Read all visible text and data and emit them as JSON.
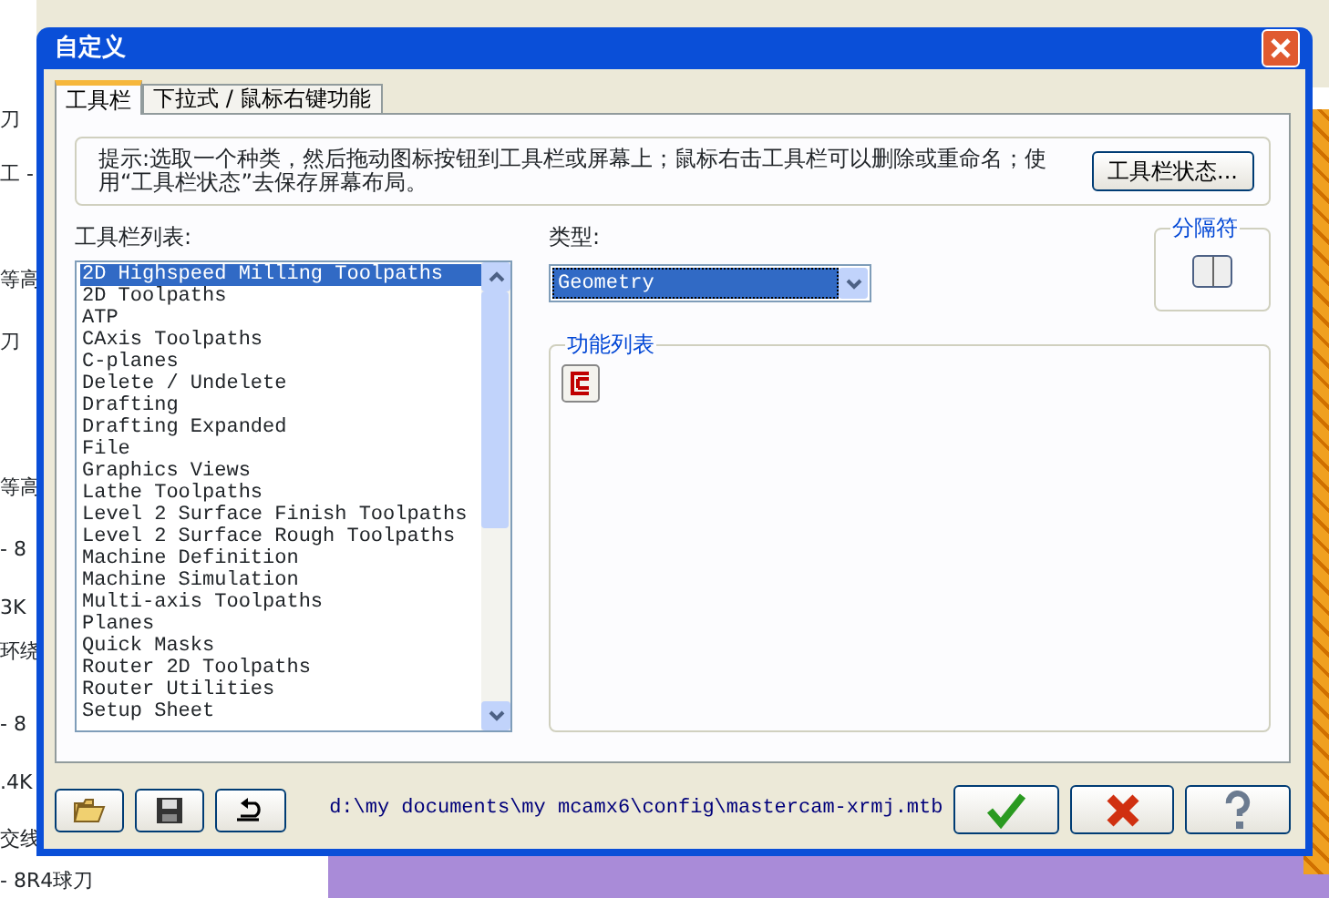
{
  "background": {
    "left_fragments": [
      "刀",
      "工 -",
      "等高",
      "刀",
      "等高",
      "- 8",
      "3K",
      "环绕",
      "- 8",
      ".4K",
      "交线",
      "- 8R4球刀"
    ]
  },
  "window": {
    "title": "自定义"
  },
  "tabs": [
    {
      "label": "工具栏",
      "selected": true
    },
    {
      "label": "下拉式 / 鼠标右键功能",
      "selected": false
    }
  ],
  "hint": "提示:选取一个种类，然后拖动图标按钮到工具栏或屏幕上；鼠标右击工具栏可以删除或重命名；使用“工具栏状态”去保存屏幕布局。",
  "state_button": "工具栏状态...",
  "toolbar_list": {
    "label": "工具栏列表:",
    "items": [
      {
        "label": "2D Highspeed Milling Toolpaths",
        "selected": true
      },
      {
        "label": "2D Toolpaths",
        "selected": false
      },
      {
        "label": "ATP",
        "selected": false
      },
      {
        "label": "CAxis Toolpaths",
        "selected": false
      },
      {
        "label": "C-planes",
        "selected": false
      },
      {
        "label": "Delete / Undelete",
        "selected": false
      },
      {
        "label": "Drafting",
        "selected": false
      },
      {
        "label": "Drafting Expanded",
        "selected": false
      },
      {
        "label": "File",
        "selected": false
      },
      {
        "label": "Graphics Views",
        "selected": false
      },
      {
        "label": "Lathe Toolpaths",
        "selected": false
      },
      {
        "label": "Level 2 Surface Finish Toolpaths",
        "selected": false
      },
      {
        "label": "Level 2 Surface Rough Toolpaths",
        "selected": false
      },
      {
        "label": "Machine Definition",
        "selected": false
      },
      {
        "label": "Machine Simulation",
        "selected": false
      },
      {
        "label": "Multi-axis Toolpaths",
        "selected": false
      },
      {
        "label": "Planes",
        "selected": false
      },
      {
        "label": "Quick Masks",
        "selected": false
      },
      {
        "label": "Router 2D Toolpaths",
        "selected": false
      },
      {
        "label": "Router Utilities",
        "selected": false
      },
      {
        "label": "Setup Sheet",
        "selected": false
      }
    ]
  },
  "type": {
    "label": "类型:",
    "value": "Geometry"
  },
  "separator": {
    "label": "分隔符"
  },
  "function_list": {
    "label": "功能列表"
  },
  "file_buttons": [
    {
      "kind": "open"
    },
    {
      "kind": "save"
    },
    {
      "kind": "reset"
    }
  ],
  "path": "d:\\my documents\\my mcamx6\\config\\mastercam-xrmj.mtb",
  "dialog_buttons": [
    {
      "kind": "ok"
    },
    {
      "kind": "cancel"
    },
    {
      "kind": "help"
    }
  ]
}
